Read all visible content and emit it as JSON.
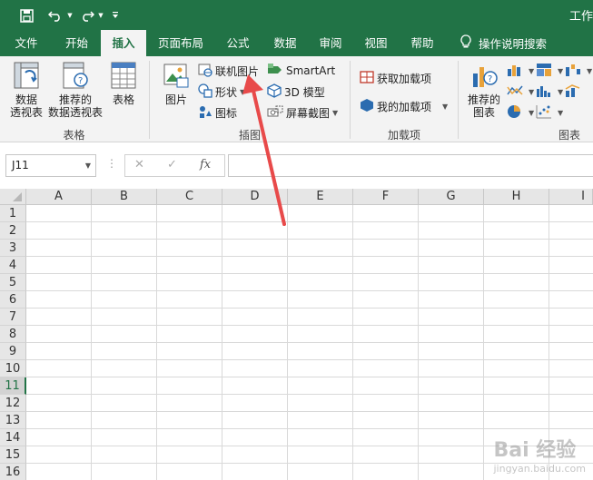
{
  "window": {
    "title": "工作"
  },
  "qat": {
    "save_icon": "save-icon",
    "undo_icon": "undo-icon",
    "redo_icon": "redo-icon",
    "customize_icon": "customize-qat-icon"
  },
  "tabs": [
    {
      "label": "文件",
      "active": false
    },
    {
      "label": "开始",
      "active": false
    },
    {
      "label": "插入",
      "active": true
    },
    {
      "label": "页面布局",
      "active": false
    },
    {
      "label": "公式",
      "active": false
    },
    {
      "label": "数据",
      "active": false
    },
    {
      "label": "审阅",
      "active": false
    },
    {
      "label": "视图",
      "active": false
    },
    {
      "label": "帮助",
      "active": false
    }
  ],
  "tell_me": {
    "label": "操作说明搜索",
    "icon": "lightbulb-icon"
  },
  "ribbon": {
    "tables": {
      "label": "表格",
      "pivot_line1": "数据",
      "pivot_line2": "透视表",
      "recommended_line1": "推荐的",
      "recommended_line2": "数据透视表",
      "table": "表格"
    },
    "illustrations": {
      "label": "插图",
      "pictures": "图片",
      "online_pictures": "联机图片",
      "shapes": "形状",
      "icons": "图标",
      "smartart": "SmartArt",
      "model3d": "3D 模型",
      "screenshot": "屏幕截图"
    },
    "addins": {
      "label": "加载项",
      "get_addins": "获取加载项",
      "my_addins": "我的加载项"
    },
    "charts": {
      "label": "图表",
      "recommended_line1": "推荐的",
      "recommended_line2": "图表"
    }
  },
  "formula_bar": {
    "name_box": "J11",
    "fx": "fx",
    "formula": ""
  },
  "grid": {
    "columns": [
      "A",
      "B",
      "C",
      "D",
      "E",
      "F",
      "G",
      "H",
      "I"
    ],
    "rows": [
      "1",
      "2",
      "3",
      "4",
      "5",
      "6",
      "7",
      "8",
      "9",
      "10",
      "11",
      "12",
      "13",
      "14",
      "15",
      "16"
    ],
    "selected_row": "11"
  },
  "watermark": {
    "text": "Bai 经验",
    "sub": "jingyan.baidu.com"
  },
  "colors": {
    "brand": "#217346",
    "arrow": "#e84a4a"
  }
}
